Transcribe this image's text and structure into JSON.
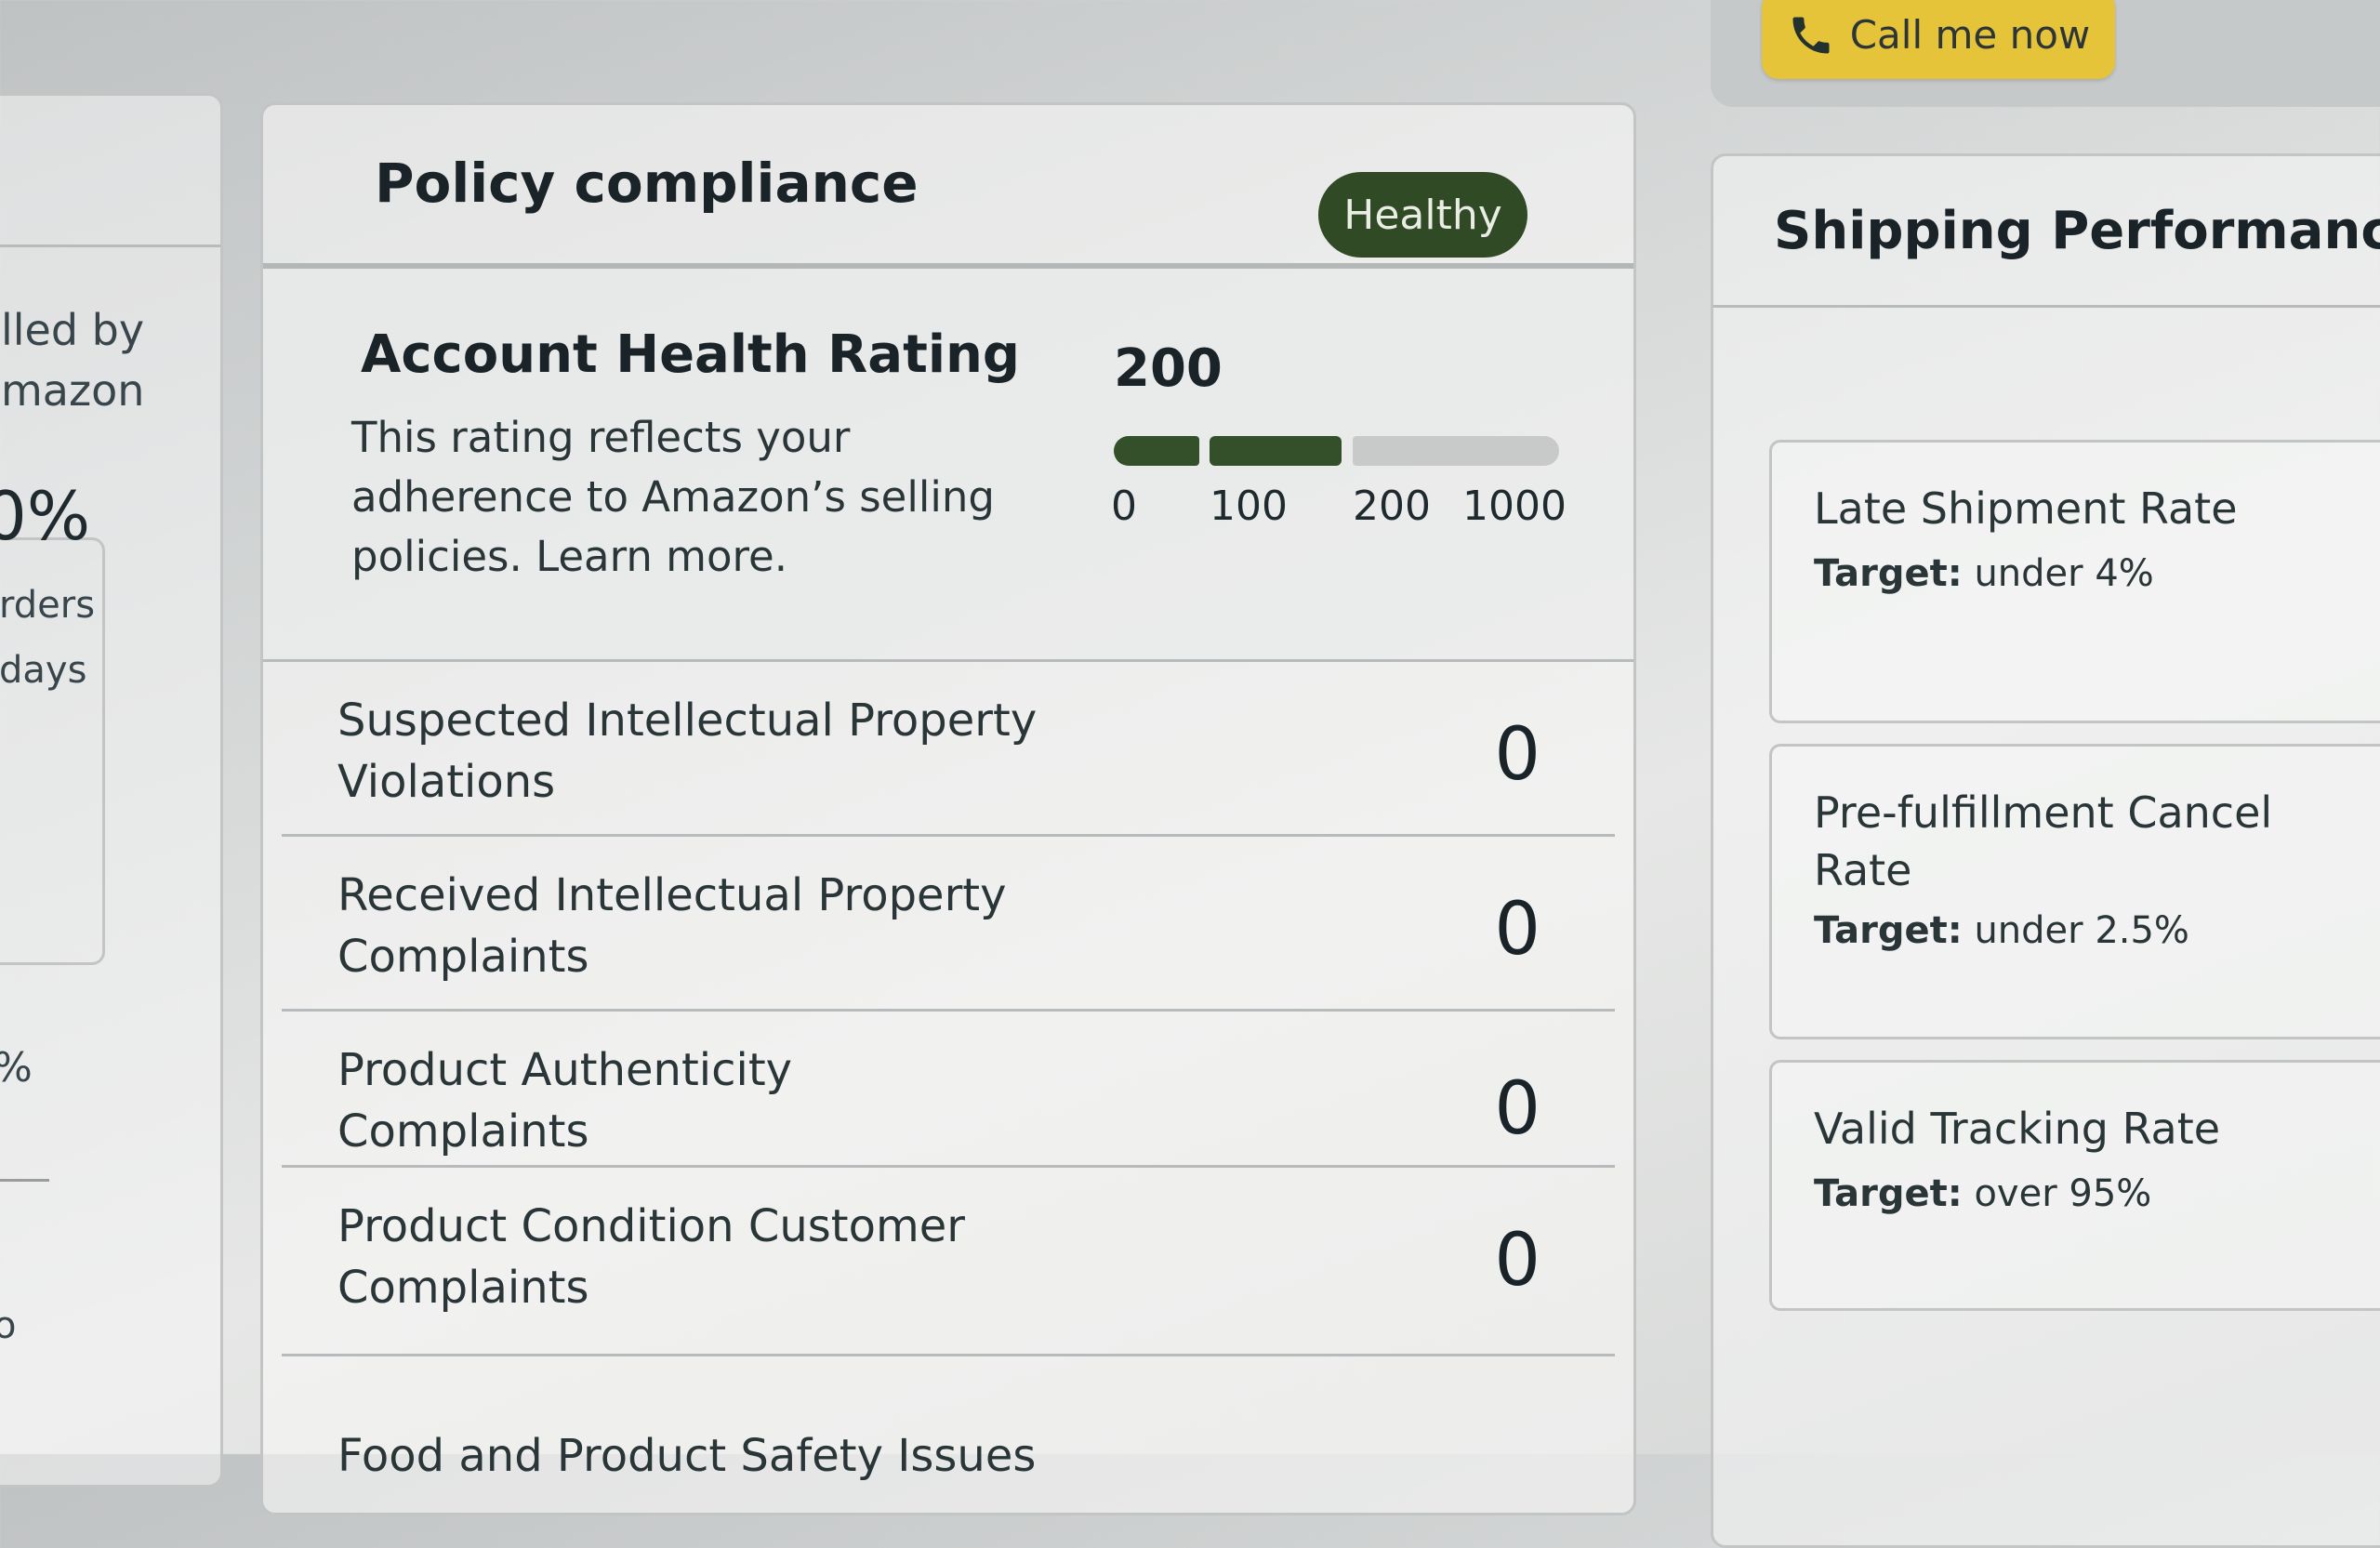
{
  "left_column": {
    "line1": "lled by",
    "line2": "mazon",
    "percent": "0%",
    "orders": "rders",
    "days": "days",
    "percent2": "%",
    "bottom_char": "o"
  },
  "call_button": {
    "label": "Call me now",
    "icon": "phone-icon"
  },
  "policy": {
    "title": "Policy compliance",
    "status_badge": "Healthy",
    "status_color": "#2f4a24",
    "account_health": {
      "title": "Account Health Rating",
      "description": "This rating reflects your adherence to Amazon’s selling policies. Learn more.",
      "score": "200",
      "scale_ticks": [
        "0",
        "100",
        "200",
        "1000"
      ],
      "scale_fill_level": "200"
    },
    "metrics": [
      {
        "label": "Suspected Intellectual Property Violations",
        "value": "0"
      },
      {
        "label": "Received Intellectual Property Complaints",
        "value": "0"
      },
      {
        "label": "Product Authenticity Complaints",
        "value": "0"
      },
      {
        "label": "Product Condition Customer Complaints",
        "value": "0"
      },
      {
        "label": "Food and Product Safety Issues",
        "value": ""
      }
    ]
  },
  "shipping": {
    "title": "Shipping Performance",
    "cards": [
      {
        "title": "Late Shipment Rate",
        "target_label": "Target:",
        "target_value": "under 4%"
      },
      {
        "title": "Pre-fulfillment Cancel Rate",
        "target_label": "Target:",
        "target_value": "under 2.5%"
      },
      {
        "title": "Valid Tracking Rate",
        "target_label": "Target:",
        "target_value": "over 95%"
      }
    ]
  },
  "colors": {
    "accent_green": "#33502a",
    "call_yellow": "#e6c43a"
  }
}
